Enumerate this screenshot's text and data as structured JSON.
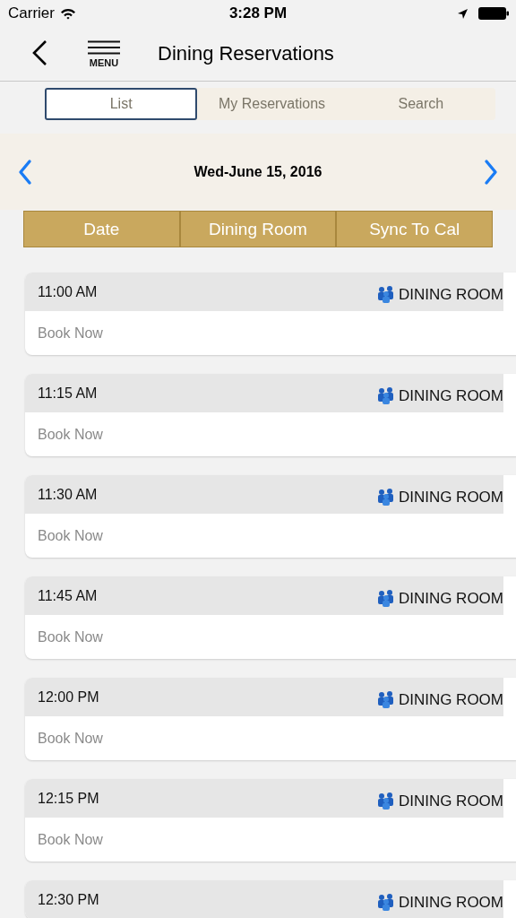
{
  "status_bar": {
    "carrier": "Carrier",
    "time": "3:28 PM"
  },
  "nav": {
    "menu_label": "MENU",
    "title": "Dining Reservations"
  },
  "tabs": [
    {
      "label": "List",
      "selected": true
    },
    {
      "label": "My Reservations",
      "selected": false
    },
    {
      "label": "Search",
      "selected": false
    }
  ],
  "date_bar": {
    "date": "Wed-June 15, 2016"
  },
  "sort_buttons": [
    "Date",
    "Dining Room",
    "Sync To Cal"
  ],
  "slots": [
    {
      "time": "11:00 AM",
      "room": "DINING ROOM",
      "action": "Book Now"
    },
    {
      "time": "11:15 AM",
      "room": "DINING ROOM",
      "action": "Book Now"
    },
    {
      "time": "11:30 AM",
      "room": "DINING ROOM",
      "action": "Book Now"
    },
    {
      "time": "11:45 AM",
      "room": "DINING ROOM",
      "action": "Book Now"
    },
    {
      "time": "12:00 PM",
      "room": "DINING ROOM",
      "action": "Book Now"
    },
    {
      "time": "12:15 PM",
      "room": "DINING ROOM",
      "action": "Book Now"
    },
    {
      "time": "12:30 PM",
      "room": "DINING ROOM"
    }
  ]
}
